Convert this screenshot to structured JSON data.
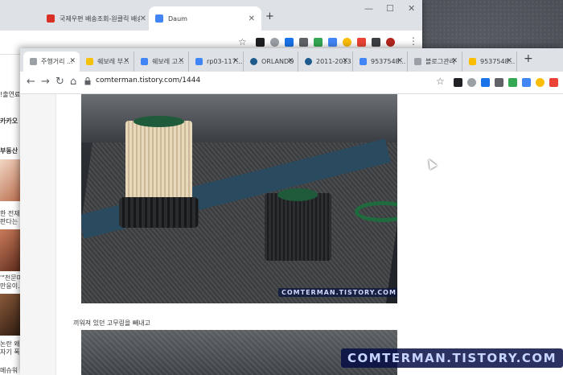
{
  "colors": {
    "tabbar": "#dee1e6",
    "accent_watermark": "#c8d6ff"
  },
  "back_window": {
    "tabs": [
      {
        "label": "국제우편 배송조회-원클릭 배송",
        "favicon_color": "#d93025",
        "active": false
      },
      {
        "label": "Daum",
        "favicon_color": "#4285f4",
        "active": true
      }
    ],
    "window_controls": {
      "minimize": "—",
      "maximize": "☐",
      "close": "✕"
    },
    "menu_icon": "⋮",
    "side_texts": [
      {
        "text": "!출연료"
      },
      {
        "text": "카카오"
      },
      {
        "text": "부동산"
      },
      {
        "text": "한 전재"
      },
      {
        "text": "판다는"
      },
      {
        "text": "'\"천문미"
      },
      {
        "text": "만응이..."
      },
      {
        "text": "논란 왜"
      },
      {
        "text": "자기 폭"
      },
      {
        "text": "메슈워"
      }
    ]
  },
  "front_window": {
    "tabs": [
      {
        "label": "주행거리 ...",
        "favicon_color": "#9aa0a6",
        "active": true
      },
      {
        "label": "쉐보레 부...",
        "favicon_color": "#f4c20d",
        "active": false
      },
      {
        "label": "쉐보레 고...",
        "favicon_color": "#4285f4",
        "active": false
      },
      {
        "label": "rp03-117...",
        "favicon_color": "#4285f4",
        "active": false
      },
      {
        "label": "ORLANDO",
        "favicon_color": "#1e5a8c",
        "active": false
      },
      {
        "label": "2011-2013",
        "favicon_color": "#1e5a8c",
        "active": false
      },
      {
        "label": "9537548...",
        "favicon_color": "#4285f4",
        "active": false
      },
      {
        "label": "블로그관리",
        "favicon_color": "#9aa0a6",
        "active": false
      },
      {
        "label": "9537548...",
        "favicon_color": "#fbbc04",
        "active": false
      }
    ],
    "new_tab_label": "+",
    "url": "comterman.tistory.com/1444",
    "page": {
      "photo_watermark": "COMTERMAN.TISTORY.COM",
      "caption": "끼워져 있던 고무링을 빼내고"
    }
  },
  "overlay_watermark": "COMTERMAN.TISTORY.COM"
}
